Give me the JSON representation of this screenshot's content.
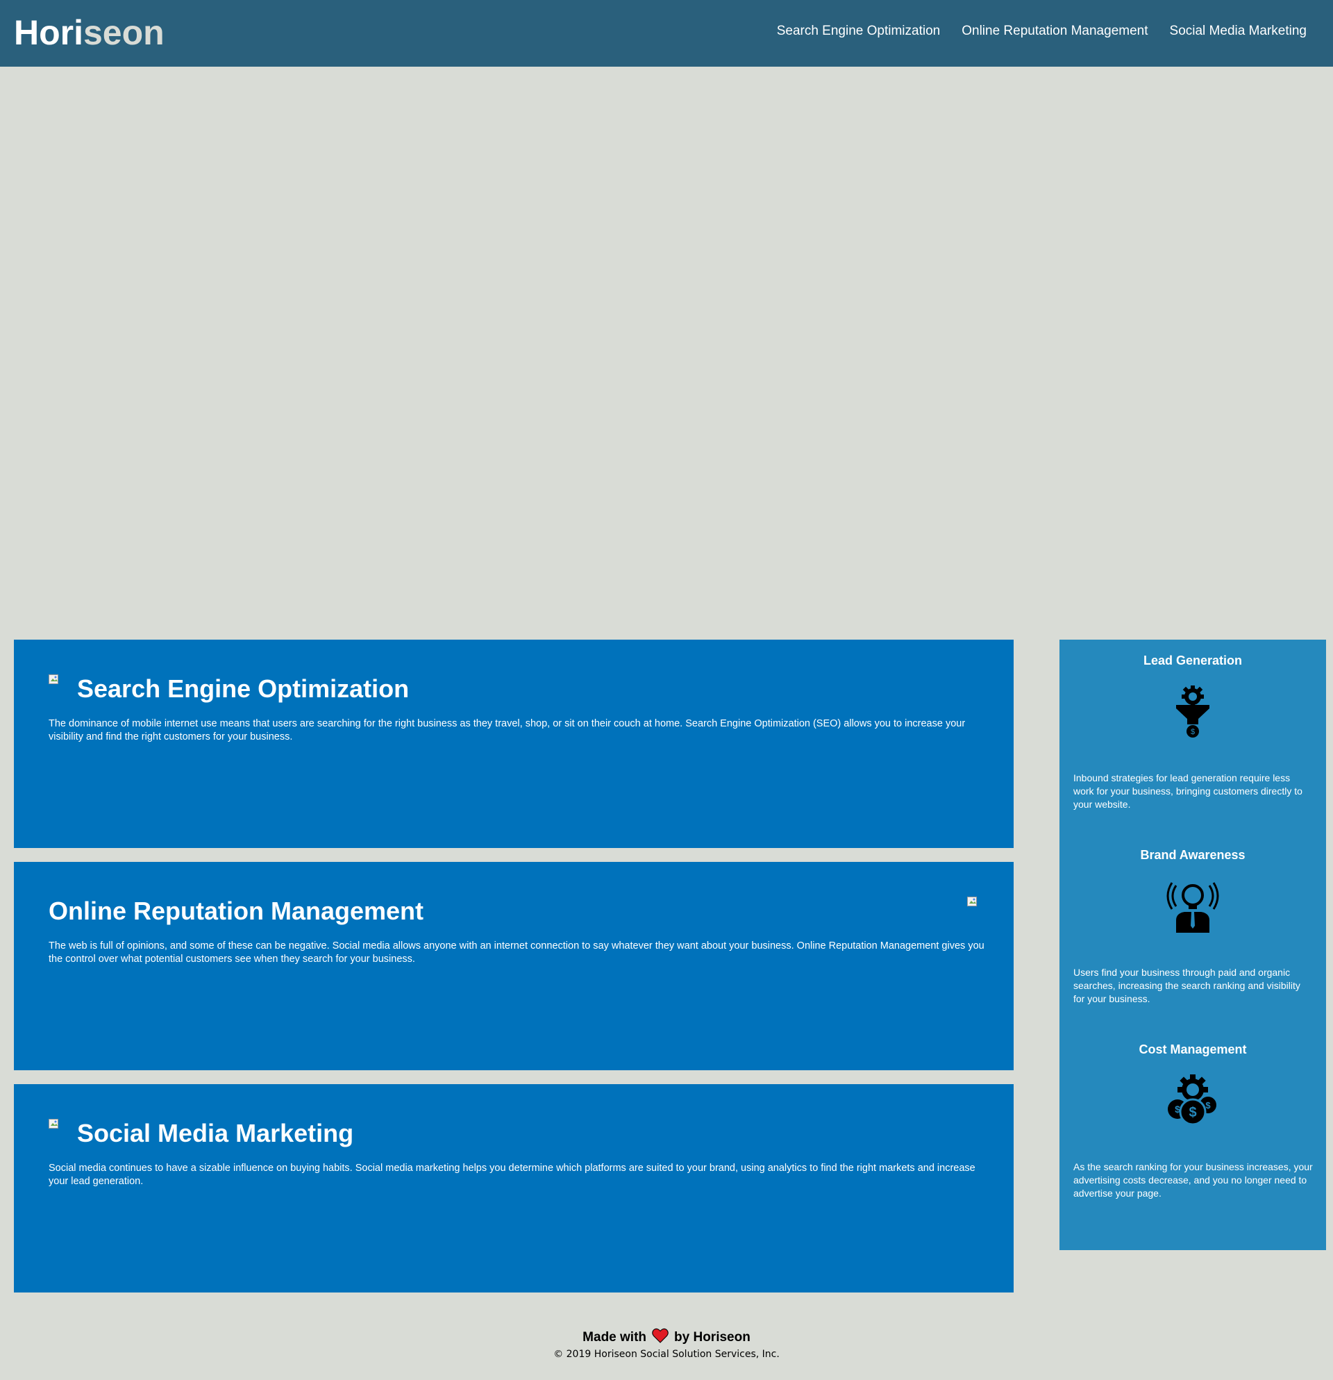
{
  "header": {
    "brand_first": "Hori",
    "brand_second": "seon",
    "nav": [
      {
        "label": "Search Engine Optimization"
      },
      {
        "label": "Online Reputation Management"
      },
      {
        "label": "Social Media Marketing"
      }
    ]
  },
  "cards": [
    {
      "title": "Search Engine Optimization",
      "body": "The dominance of mobile internet use means that users are searching for the right business as they travel, shop, or sit on their couch at home. Search Engine Optimization (SEO) allows you to increase your visibility and find the right customers for your business."
    },
    {
      "title": "Online Reputation Management",
      "body": "The web is full of opinions, and some of these can be negative. Social media allows anyone with an internet connection to say whatever they want about your business. Online Reputation Management gives you the control over what potential customers see when they search for your business."
    },
    {
      "title": "Social Media Marketing",
      "body": "Social media continues to have a sizable influence on buying habits. Social media marketing helps you determine which platforms are suited to your brand, using analytics to find the right markets and increase your lead generation."
    }
  ],
  "sidebar": [
    {
      "title": "Lead Generation",
      "icon": "lead-generation-icon",
      "body": "Inbound strategies for lead generation require less work for your business, bringing customers directly to your website."
    },
    {
      "title": "Brand Awareness",
      "icon": "brand-awareness-icon",
      "body": "Users find your business through paid and organic searches, increasing the search ranking and visibility for your business."
    },
    {
      "title": "Cost Management",
      "icon": "cost-management-icon",
      "body": "As the search ranking for your business increases, your advertising costs decrease, and you no longer need to advertise your page."
    }
  ],
  "footer": {
    "made_prefix": "Made with",
    "made_suffix": "by Horiseon",
    "copyright": "© 2019 Horiseon Social Solution Services, Inc."
  },
  "colors": {
    "header_bg": "#2a607c",
    "page_bg": "#d9dcd6",
    "card_bg": "#0072bb",
    "sidebar_bg": "#2589bd",
    "heart": "#e01b24"
  }
}
